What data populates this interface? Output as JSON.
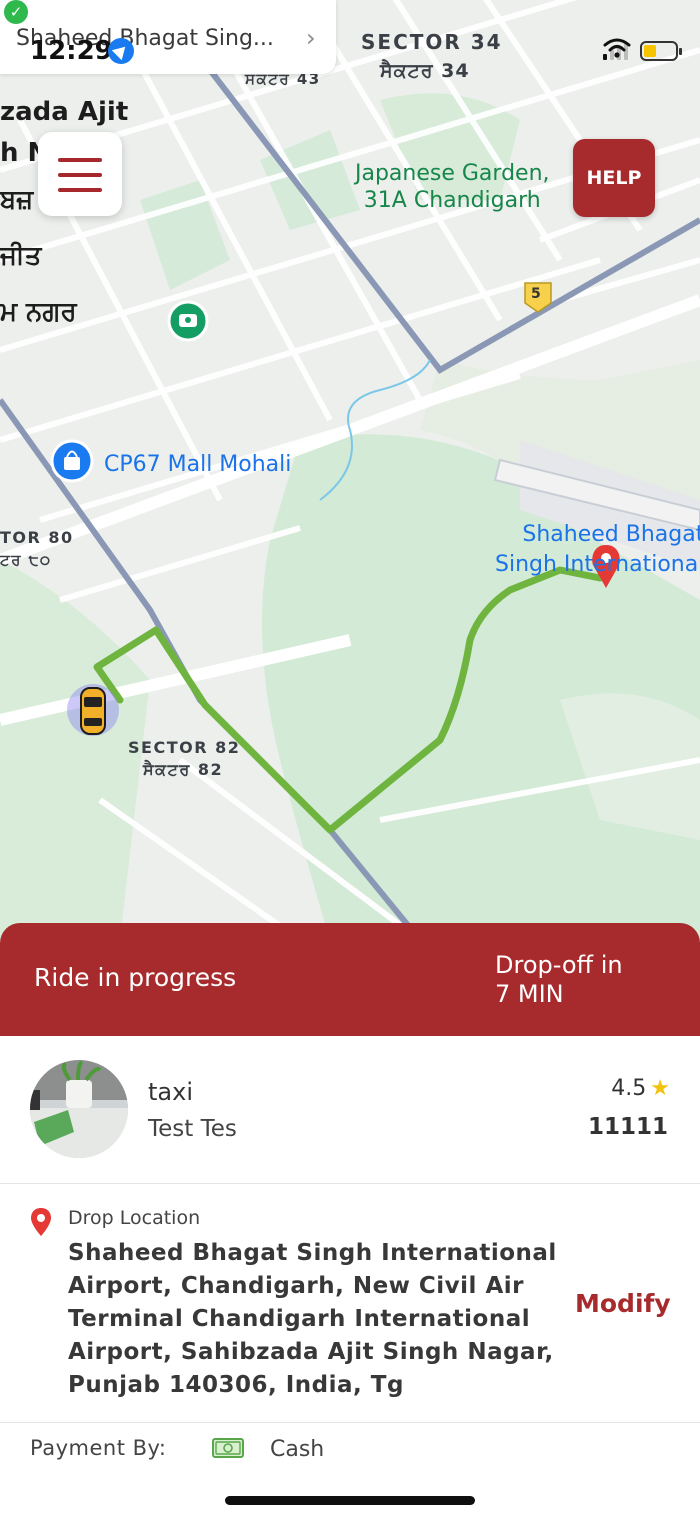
{
  "status_bar": {
    "time": "12:29",
    "back_app_label": "Shaheed Bhagat Sing...",
    "battery_level": 0.35,
    "signal_bars": 1
  },
  "map": {
    "labels": {
      "sector_34": "SECTOR 34",
      "sector_34_pa": "ਸੈਕਟਰ 34",
      "sector_43_pa": "ਸਕਟਰ 43",
      "city_line1": "zada Ajit",
      "city_line2": "h N",
      "city_line3": "ਬਜ਼",
      "city_line4": "ਜੀਤ",
      "city_line5": "ਮ ਨਗਰ",
      "garden": "Japanese Garden,\n31A Chandigarh",
      "highway": "5",
      "mall": "CP67 Mall Mohali",
      "sector_80": "TOR 80",
      "sector_80_pa": "ਟਰ ੮੦",
      "airport": "Shaheed Bhagat\nSingh International",
      "sector_82": "SECTOR 82",
      "sector_82_pa": "ਸੈਕਟਰ 82"
    },
    "route_color": "#6fb43f",
    "icons": [
      "menu-icon",
      "help-button",
      "car-icon",
      "destination-pin-icon",
      "mall-pin-icon",
      "park-pin-icon"
    ]
  },
  "menu": {
    "icon": "hamburger-menu-icon"
  },
  "help": {
    "label": "HELP"
  },
  "ride": {
    "status": "Ride in progress",
    "eta_line1": "Drop-off in",
    "eta_line2": "7 MIN"
  },
  "driver": {
    "name": "taxi",
    "subtitle": "Test Tes",
    "rating": "4.5",
    "rating_icon": "star-icon",
    "id": "11111"
  },
  "drop": {
    "title": "Drop Location",
    "address": "Shaheed Bhagat Singh International Airport,  Chandigarh, New Civil Air Terminal Chandigarh International Airport, Sahibzada Ajit Singh Nagar, Punjab 140306, India,  Tg",
    "modify_label": "Modify"
  },
  "payment": {
    "label": "Payment By:",
    "method": "Cash",
    "method_icon": "cash-icon"
  },
  "colors": {
    "brand": "#a72b2d",
    "route": "#6fb43f",
    "link_blue": "#1a73e8",
    "park_green": "#17864a"
  }
}
